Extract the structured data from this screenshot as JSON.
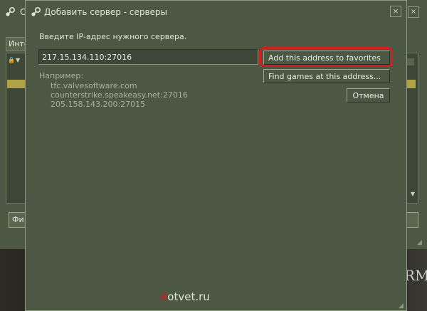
{
  "background_window": {
    "title": "Се",
    "tab_label": "Инте",
    "filter_button_label": "Фи",
    "game_text": "RM"
  },
  "dialog": {
    "title": "Добавить сервер - серверы",
    "instruction": "Введите IP-адрес нужного сервера.",
    "address_value": "217.15.134.110:27016",
    "add_button_label": "Add this address to favorites",
    "find_button_label": "Find games at this address...",
    "cancel_button_label": "Отмена",
    "example_label": "Например:",
    "examples": [
      "tfc.valvesoftware.com",
      "counterstrike.speakeasy.net:27016",
      "205.158.143.200:27015"
    ],
    "close_glyph": "×",
    "highlight_color": "#d21e1e"
  },
  "watermark": {
    "first_letter": "B",
    "rest": "otvet.ru"
  },
  "icons": {
    "steam": "steam-icon",
    "close": "close-icon",
    "lock": "lock-icon",
    "shield": "shield-icon",
    "scroll_down": "scroll-down-arrow-icon",
    "resize": "resize-grip-icon"
  }
}
